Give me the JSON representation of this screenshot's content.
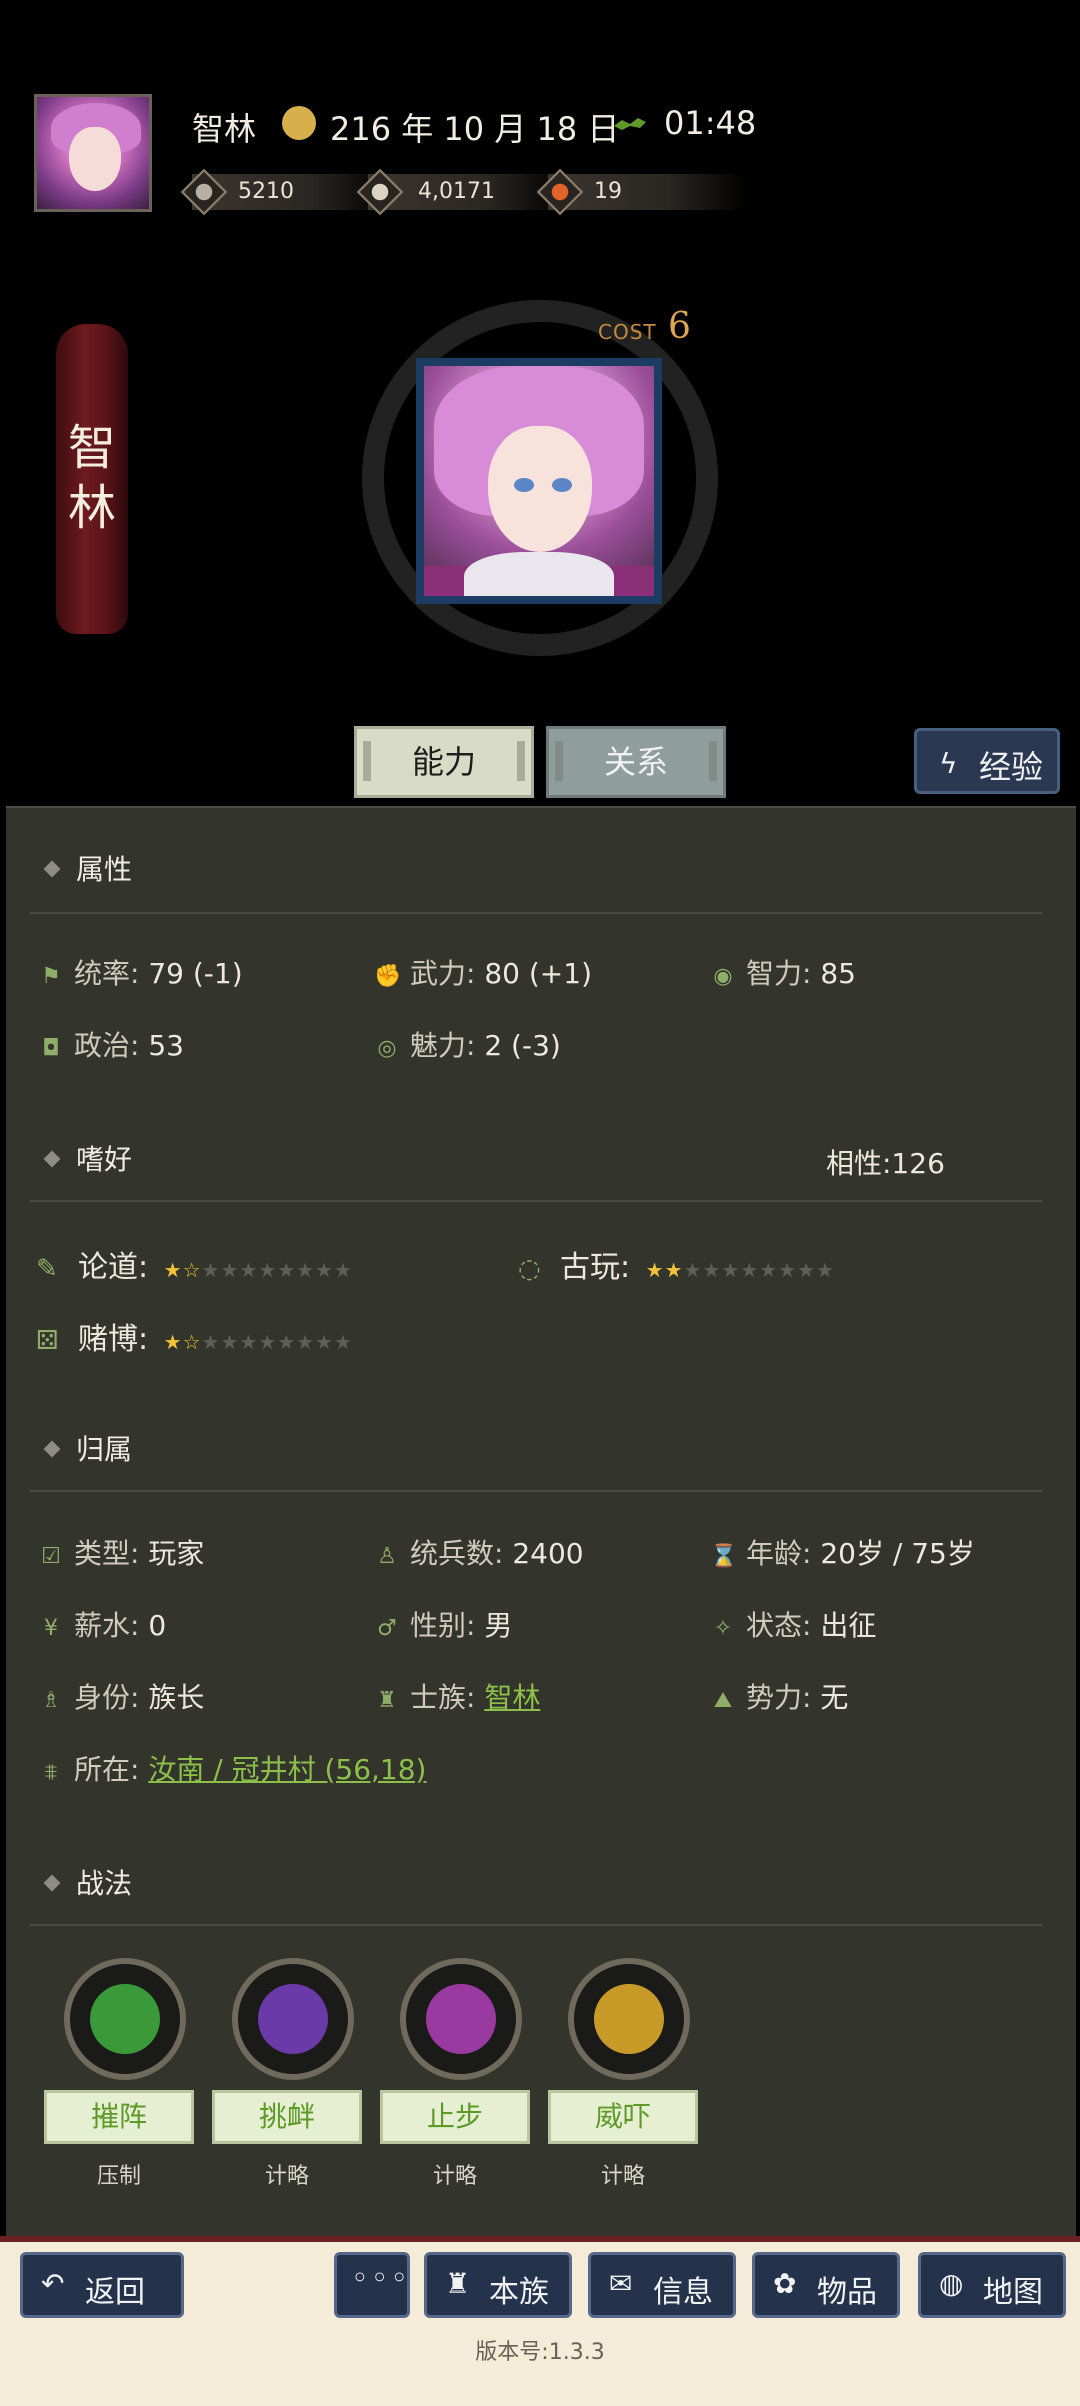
{
  "header": {
    "player_name": "智林",
    "date": "216 年 10 月 18 日",
    "time": "01:48",
    "resources": [
      {
        "icon": "coin-icon",
        "value": "5210"
      },
      {
        "icon": "rice-icon",
        "value": "4,0171"
      },
      {
        "icon": "food-icon",
        "value": "19"
      }
    ]
  },
  "hero": {
    "name_chars": [
      "智",
      "林"
    ],
    "cost_label": "COST",
    "cost_value": "6"
  },
  "tabs": {
    "ability": "能力",
    "relation": "关系",
    "experience": "经验"
  },
  "attributes": {
    "title": "属性",
    "items": [
      {
        "label": "统率:",
        "value": "79 (-1)",
        "icon": "flag-icon"
      },
      {
        "label": "武力:",
        "value": "80 (+1)",
        "icon": "fist-icon"
      },
      {
        "label": "智力:",
        "value": "85",
        "icon": "brain-icon"
      },
      {
        "label": "政治:",
        "value": "53",
        "icon": "bag-icon"
      },
      {
        "label": "魅力:",
        "value": "2 (-3)",
        "icon": "eye-icon"
      }
    ]
  },
  "hobbies": {
    "title": "嗜好",
    "affinity": "相性:126",
    "items": [
      {
        "label": "论道:",
        "stars": 1.5,
        "max": 10,
        "icon": "scroll-icon"
      },
      {
        "label": "古玩:",
        "stars": 2,
        "max": 10,
        "icon": "jade-icon"
      },
      {
        "label": "赌博:",
        "stars": 1.5,
        "max": 10,
        "icon": "dice-icon"
      }
    ]
  },
  "belonging": {
    "title": "归属",
    "items": [
      {
        "label": "类型:",
        "value": "玩家",
        "icon": "checkbox-icon"
      },
      {
        "label": "统兵数:",
        "value": "2400",
        "icon": "soldier-icon"
      },
      {
        "label": "年龄:",
        "value": "20岁 / 75岁",
        "icon": "hourglass-icon"
      },
      {
        "label": "薪水:",
        "value": "0",
        "icon": "yen-icon"
      },
      {
        "label": "性别:",
        "value": "男",
        "icon": "gender-icon"
      },
      {
        "label": "状态:",
        "value": "出征",
        "icon": "status-icon"
      },
      {
        "label": "身份:",
        "value": "族长",
        "icon": "figure-icon"
      },
      {
        "label": "士族:",
        "value": "智林",
        "icon": "clan-icon",
        "link": true
      },
      {
        "label": "势力:",
        "value": "无",
        "icon": "mountain-icon"
      }
    ],
    "location_label": "所在:",
    "location_value": "汝南 / 冠井村 (56,18)"
  },
  "tactics": {
    "title": "战法",
    "skills": [
      {
        "name": "摧阵",
        "type": "压制",
        "color": "#3a9a3a"
      },
      {
        "name": "挑衅",
        "type": "计略",
        "color": "#6a3aa8"
      },
      {
        "name": "止步",
        "type": "计略",
        "color": "#9a3aa0"
      },
      {
        "name": "威吓",
        "type": "计略",
        "color": "#c89a28"
      }
    ]
  },
  "bottom": {
    "back": "返回",
    "more": "◦◦◦",
    "clan": "本族",
    "info": "信息",
    "items": "物品",
    "map": "地图",
    "version": "版本号:1.3.3"
  }
}
